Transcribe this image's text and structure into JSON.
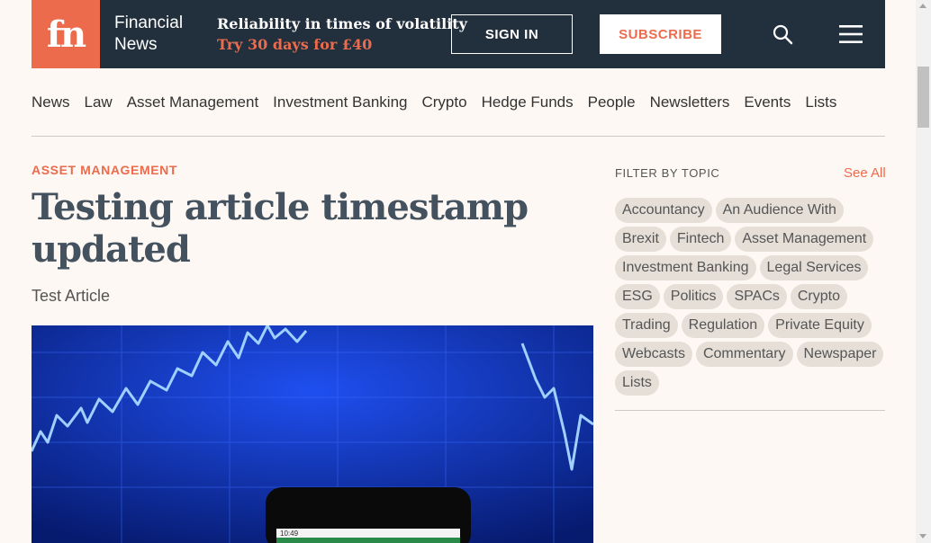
{
  "header": {
    "logo_text": "fn",
    "brand_line1": "Financial",
    "brand_line2": "News",
    "promo_line1": "Reliability in times of volatility",
    "promo_line2": "Try 30 days for £40",
    "signin_label": "SIGN IN",
    "subscribe_label": "SUBSCRIBE",
    "search_icon": "search-icon",
    "menu_icon": "hamburger-menu-icon"
  },
  "nav": {
    "items": [
      "News",
      "Law",
      "Asset Management",
      "Investment Banking",
      "Crypto",
      "Hedge Funds",
      "People",
      "Newsletters",
      "Events",
      "Lists"
    ]
  },
  "article": {
    "kicker": "ASSET MANAGEMENT",
    "headline": "Testing article timestamp updated",
    "subhead": "Test Article",
    "phone_status_time": "10:49"
  },
  "sidebar": {
    "filter_label": "FILTER BY TOPIC",
    "see_all": "See All",
    "tags": [
      "Accountancy",
      "An Audience With",
      "Brexit",
      "Fintech",
      "Asset Management",
      "Investment Banking",
      "Legal Services",
      "ESG",
      "Politics",
      "SPACs",
      "Crypto",
      "Trading",
      "Regulation",
      "Private Equity",
      "Webcasts",
      "Commentary",
      "Newspaper",
      "Lists"
    ]
  },
  "colors": {
    "accent": "#ec6b4c",
    "header_bg": "#22303e",
    "page_bg": "#fdf8f3",
    "headline": "#44525f"
  }
}
